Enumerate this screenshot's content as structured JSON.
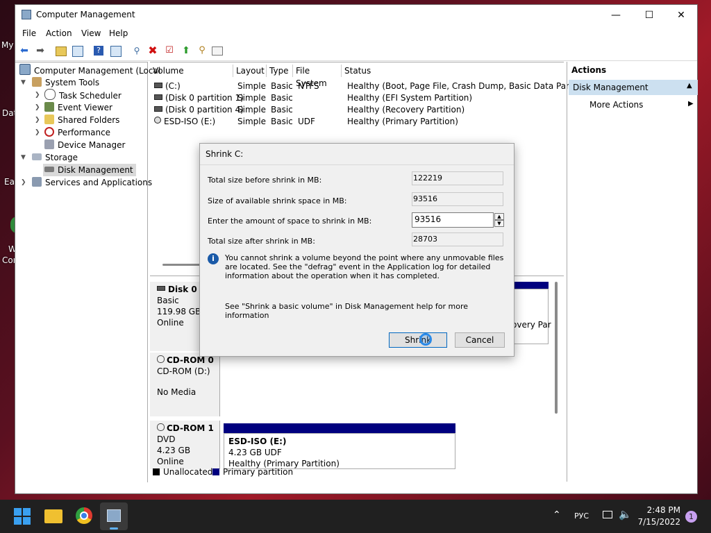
{
  "desktop": {
    "icons": [
      "My",
      "Dat",
      "Eas",
      "W",
      "Cor"
    ]
  },
  "window": {
    "title": "Computer Management",
    "menu": [
      "File",
      "Action",
      "View",
      "Help"
    ]
  },
  "tree": {
    "root": "Computer Management (Local",
    "system_tools": "System Tools",
    "task_scheduler": "Task Scheduler",
    "event_viewer": "Event Viewer",
    "shared_folders": "Shared Folders",
    "performance": "Performance",
    "device_manager": "Device Manager",
    "storage": "Storage",
    "disk_management": "Disk Management",
    "services": "Services and Applications"
  },
  "list": {
    "headers": [
      "Volume",
      "Layout",
      "Type",
      "File System",
      "Status"
    ],
    "rows": [
      {
        "volume": "(C:)",
        "layout": "Simple",
        "type": "Basic",
        "fs": "NTFS",
        "status": "Healthy (Boot, Page File, Crash Dump, Basic Data Partition)"
      },
      {
        "volume": "(Disk 0 partition 1)",
        "layout": "Simple",
        "type": "Basic",
        "fs": "",
        "status": "Healthy (EFI System Partition)"
      },
      {
        "volume": "(Disk 0 partition 4)",
        "layout": "Simple",
        "type": "Basic",
        "fs": "",
        "status": "Healthy (Recovery Partition)"
      },
      {
        "volume": "ESD-ISO (E:)",
        "layout": "Simple",
        "type": "Basic",
        "fs": "UDF",
        "status": "Healthy (Primary Partition)"
      }
    ]
  },
  "graph": {
    "disk0": {
      "name": "Disk 0",
      "type": "Basic",
      "size": "119.98 GB",
      "state": "Online",
      "partition_fragment": "overy Par"
    },
    "cdrom0": {
      "name": "CD-ROM 0",
      "drive": "CD-ROM (D:)",
      "state": "No Media"
    },
    "cdrom1": {
      "name": "CD-ROM 1",
      "type": "DVD",
      "size": "4.23 GB",
      "state": "Online",
      "part_name": "ESD-ISO  (E:)",
      "part_size": "4.23 GB UDF",
      "part_status": "Healthy (Primary Partition)"
    },
    "legend": [
      "Unallocated",
      "Primary partition"
    ]
  },
  "actions": {
    "header": "Actions",
    "section": "Disk Management",
    "more": "More Actions"
  },
  "dialog": {
    "title": "Shrink C:",
    "label_total_before": "Total size before shrink in MB:",
    "value_total_before": "122219",
    "label_available": "Size of available shrink space in MB:",
    "value_available": "93516",
    "label_enter": "Enter the amount of space to shrink in MB:",
    "value_enter": "93516",
    "label_after": "Total size after shrink in MB:",
    "value_after": "28703",
    "info": "You cannot shrink a volume beyond the point where any unmovable files are located. See the \"defrag\" event in the Application log for detailed information about the operation when it has completed.",
    "help": "See \"Shrink a basic volume\" in Disk Management help for more information",
    "shrink": "Shrink",
    "cancel": "Cancel"
  },
  "taskbar": {
    "lang": "РУС",
    "time": "2:48 PM",
    "date": "7/15/2022",
    "badge": "1"
  },
  "colors": {
    "primary_partition": "#00007f",
    "selection": "#cce0f0",
    "accent": "#0067c0"
  }
}
